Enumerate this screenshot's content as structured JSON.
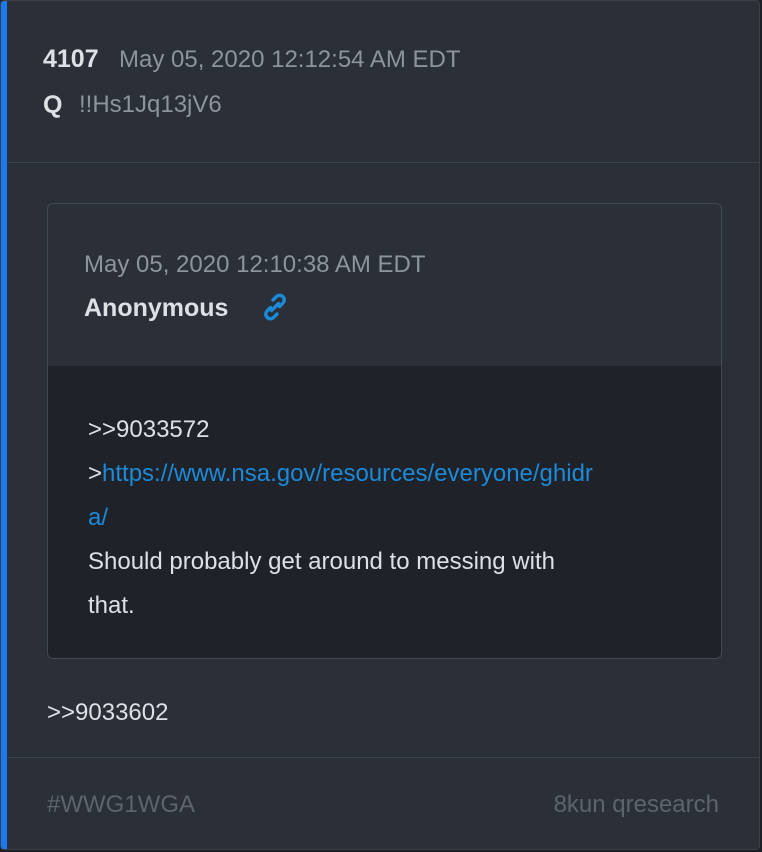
{
  "post": {
    "number": "4107",
    "date": "May 05, 2020 12:12:54 AM EDT",
    "author": "Q",
    "tripcode": "!!Hs1Jq13jV6",
    "accent_color": "#1a7aef"
  },
  "quoted_post": {
    "date": "May 05, 2020 12:10:38 AM EDT",
    "author": "Anonymous",
    "link_icon": "link-icon",
    "lines": {
      "ref": ">>9033572",
      "greentext_prefix": ">",
      "url_part1": "https://www.nsa.gov/resources/everyone/ghidr",
      "url_part2": "a/",
      "text_line1": "Should probably get around to messing with",
      "text_line2": "that."
    },
    "link_color": "#1c8ad8"
  },
  "reply": {
    "ref": ">>9033602"
  },
  "footer": {
    "tag": "#WWG1WGA",
    "source": "8kun qresearch"
  }
}
